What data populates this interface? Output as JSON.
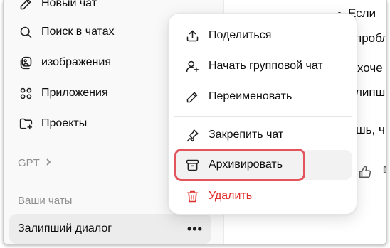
{
  "sidebar": {
    "items": [
      {
        "label": "Новый чат",
        "icon": "new-chat-icon"
      },
      {
        "label": "Поиск в чатах",
        "icon": "search-icon"
      },
      {
        "label": "изображения",
        "icon": "images-icon"
      },
      {
        "label": "Приложения",
        "icon": "apps-icon"
      },
      {
        "label": "Проекты",
        "icon": "folder-plus-icon"
      }
    ],
    "gpt_label": "GPT",
    "chats_section_label": "Ваши чаты",
    "active_chat": {
      "title": "Залипший диалог",
      "more_label": "•••"
    }
  },
  "menu": {
    "items": [
      {
        "label": "Поделиться",
        "icon": "share-icon"
      },
      {
        "label": "Начать групповой чат",
        "icon": "add-user-icon"
      },
      {
        "label": "Переименовать",
        "icon": "pencil-icon"
      },
      {
        "label": "Закрепить чат",
        "icon": "pin-icon"
      },
      {
        "label": "Архивировать",
        "icon": "archive-icon"
      },
      {
        "label": "Удалить",
        "icon": "trash-icon"
      }
    ],
    "highlighted_item": "Архивировать"
  },
  "main": {
    "lines": [
      "Если",
      "пробл",
      "хоче",
      "липши",
      "шь, ч"
    ]
  },
  "colors": {
    "sidebar_bg": "#f9f9f9",
    "active_row_bg": "#ececec",
    "danger": "#e02e2a",
    "highlight_box": "#e3545c"
  }
}
